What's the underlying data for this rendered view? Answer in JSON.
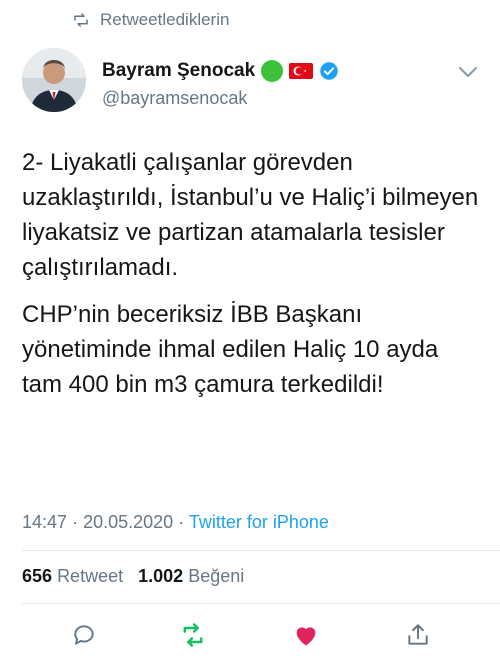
{
  "context": {
    "label": "Retweetlediklerin"
  },
  "author": {
    "name": "Bayram Şenocak",
    "handle": "@bayramsenocak"
  },
  "tweet": {
    "paragraphs": [
      "2- Liyakatli çalışanlar görevden uzaklaştırıldı, İstanbul’u ve Haliç’i bilmeyen liyakatsiz ve partizan atamalarla tesisler çalıştırılamadı.",
      "CHP’nin beceriksiz İBB Başkanı yönetiminde ihmal edilen Haliç 10 ayda tam 400 bin m3 çamura terkedildi!"
    ],
    "time": "14:47",
    "date": "20.05.2020",
    "separator": "·",
    "source": "Twitter for iPhone"
  },
  "stats": {
    "retweets_count": "656",
    "retweets_label": "Retweet",
    "likes_count": "1.002",
    "likes_label": "Beğeni"
  },
  "colors": {
    "accent": "#1da1f2",
    "retweeted": "#17bf63",
    "liked": "#e0245e",
    "muted": "#657786"
  },
  "icons": {
    "context": "retweet-icon",
    "menu": "chevron-down-icon",
    "actions": [
      "reply-icon",
      "retweet-icon",
      "like-icon",
      "share-icon"
    ]
  }
}
